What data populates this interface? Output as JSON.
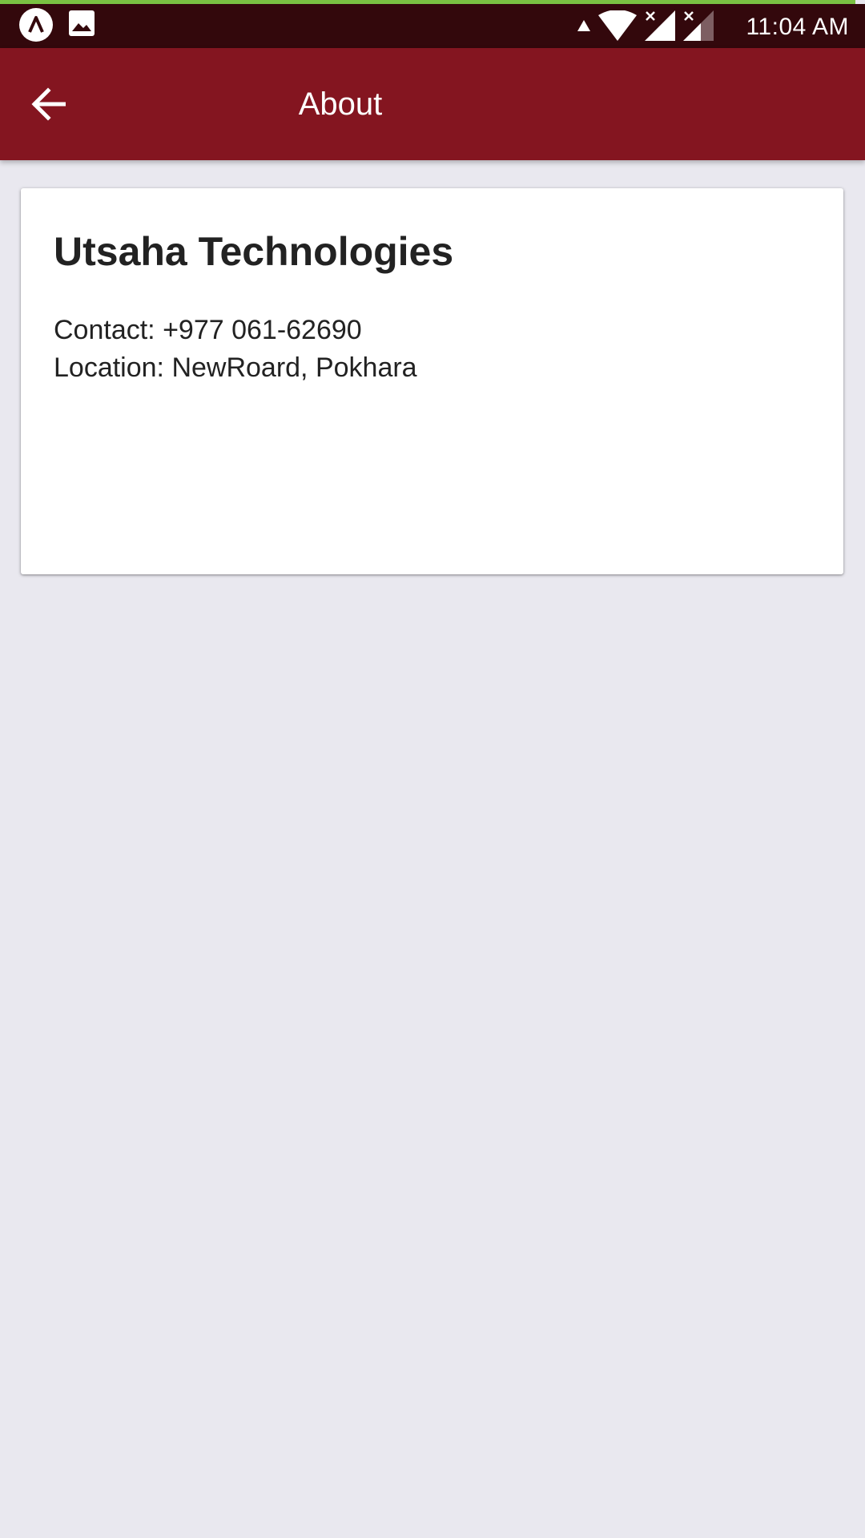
{
  "status_bar": {
    "time": "11:04 AM",
    "icons": [
      "app-notification-icon",
      "image-notification-icon",
      "data-arrow-icon",
      "wifi-icon",
      "signal-no-sim-icon",
      "signal-weak-icon"
    ]
  },
  "app_bar": {
    "title": "About",
    "back_icon": "arrow-back-icon",
    "background_color": "#841520"
  },
  "about_card": {
    "company_name": "Utsaha Technologies",
    "contact": "Contact: +977 061-62690",
    "location": "Location: NewRoard, Pokhara"
  },
  "colors": {
    "status_bar": "#33080c",
    "accent_line": "#7ac142",
    "page_background": "#e9e8ef"
  }
}
